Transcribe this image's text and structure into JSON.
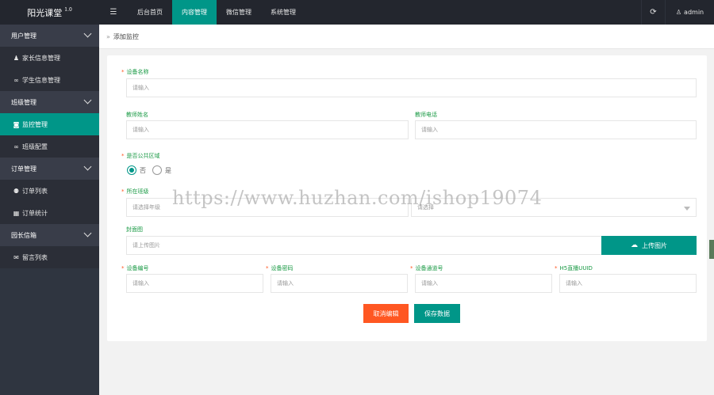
{
  "app": {
    "logo": "阳光课堂",
    "version": "1.0"
  },
  "topnav": {
    "toggle_icon": "☰",
    "items": [
      "后台首页",
      "内容管理",
      "微信管理",
      "系统管理"
    ],
    "active_index": 1,
    "refresh_icon": "⟳",
    "user_icon": "♙",
    "user": "admin"
  },
  "sidebar": {
    "groups": [
      {
        "label": "用户管理",
        "items": [
          {
            "icon": "user-icon",
            "glyph": "♟",
            "label": "家长信息管理"
          },
          {
            "icon": "link-icon",
            "glyph": "∞",
            "label": "学生信息管理"
          }
        ]
      },
      {
        "label": "班级管理",
        "items": [
          {
            "icon": "camera-icon",
            "glyph": "◙",
            "label": "监控管理",
            "active": true
          },
          {
            "icon": "link-icon",
            "glyph": "∞",
            "label": "班级配置"
          }
        ]
      },
      {
        "label": "订单管理",
        "items": [
          {
            "icon": "group-icon",
            "glyph": "⚉",
            "label": "订单列表"
          },
          {
            "icon": "bar-chart-icon",
            "glyph": "▦",
            "label": "订单统计"
          }
        ]
      },
      {
        "label": "园长信箱",
        "items": [
          {
            "icon": "envelope-icon",
            "glyph": "✉",
            "label": "留言列表"
          }
        ]
      }
    ]
  },
  "breadcrumb": {
    "sep": "»",
    "current": "添加监控"
  },
  "form": {
    "device_name": {
      "label": "设备名称",
      "placeholder": "请输入"
    },
    "teacher_name": {
      "label": "教师姓名",
      "placeholder": "请输入"
    },
    "teacher_phone": {
      "label": "教师电话",
      "placeholder": "请输入"
    },
    "public_area": {
      "label": "是否公共区域",
      "options": [
        "否",
        "是"
      ],
      "selected": "否"
    },
    "class": {
      "label": "所在班级",
      "grade_placeholder": "请选择年级",
      "class_placeholder": "请选择"
    },
    "cover": {
      "label": "封面图",
      "placeholder": "请上传图片",
      "upload_label": "上传图片",
      "upload_icon": "☁"
    },
    "device_no": {
      "label": "设备编号",
      "placeholder": "请输入"
    },
    "device_code": {
      "label": "设备密码",
      "placeholder": "请输入"
    },
    "channel_no": {
      "label": "设备通道号",
      "placeholder": "请输入"
    },
    "h5_uuid": {
      "label": "H5直播UUID",
      "placeholder": "请输入"
    },
    "cancel_label": "取消编辑",
    "save_label": "保存数据"
  },
  "watermark": "https://www.huzhan.com/ishop19074",
  "colors": {
    "accent": "#009688",
    "danger": "#ff5722",
    "topbar": "#23262e",
    "sidebar": "#2f3540",
    "label": "#1a9a45"
  }
}
